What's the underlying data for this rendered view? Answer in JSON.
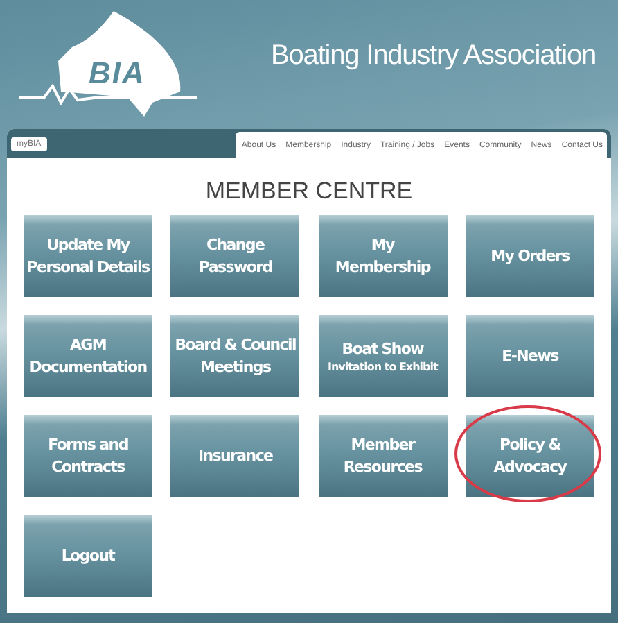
{
  "header": {
    "logo_text": "BIA",
    "title": "Boating Industry Association"
  },
  "nav": {
    "account_button": "myBIA",
    "items": [
      {
        "label": "About Us",
        "selected": false
      },
      {
        "label": "Membership",
        "selected": false
      },
      {
        "label": "Industry",
        "selected": false
      },
      {
        "label": "Training / Jobs",
        "selected": false
      },
      {
        "label": "Events",
        "selected": false
      },
      {
        "label": "Community",
        "selected": false
      },
      {
        "label": "News",
        "selected": false
      },
      {
        "label": "Contact Us",
        "selected": false
      }
    ]
  },
  "heading": "MEMBER CENTRE",
  "tiles": [
    {
      "lines": [
        "Update My",
        "Personal Details"
      ],
      "circled": false
    },
    {
      "lines": [
        "Change",
        "Password"
      ],
      "circled": false
    },
    {
      "lines": [
        "My",
        "Membership"
      ],
      "circled": false
    },
    {
      "lines": [
        "My Orders"
      ],
      "circled": false
    },
    {
      "lines": [
        "AGM",
        "Documentation"
      ],
      "circled": false
    },
    {
      "lines": [
        "Board & Council",
        "Meetings"
      ],
      "circled": false
    },
    {
      "lines": [
        "Boat Show"
      ],
      "subtitle": "Invitation to Exhibit",
      "circled": false
    },
    {
      "lines": [
        "E-News"
      ],
      "circled": false
    },
    {
      "lines": [
        "Forms and",
        "Contracts"
      ],
      "circled": false
    },
    {
      "lines": [
        "Insurance"
      ],
      "circled": false
    },
    {
      "lines": [
        "Member",
        "Resources"
      ],
      "circled": false
    },
    {
      "lines": [
        "Policy &",
        "Advocacy"
      ],
      "circled": true
    },
    {
      "lines": [
        "Logout"
      ],
      "circled": false
    }
  ]
}
